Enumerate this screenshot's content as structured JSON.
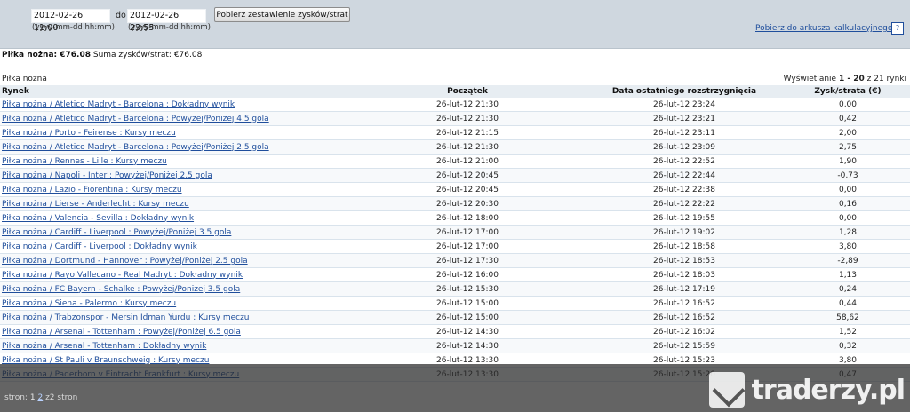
{
  "filter": {
    "from_value": "2012-02-26 11:00",
    "to_label": "do",
    "to_value": "2012-02-26 23:55",
    "from_format": "(yyyy-mm-dd hh:mm)",
    "to_format": "(yyyy-mm-dd hh:mm)",
    "button_label": "Pobierz zestawienie zysków/strat",
    "export_link": "Pobierz do arkusza kalkulacyjnego",
    "help_label": "?"
  },
  "summary": {
    "sport_label": "Piłka nożna: €76.08",
    "total_label": "Suma zysków/strat:",
    "total_value": "€76.08"
  },
  "table": {
    "section_label": "Piłka nożna",
    "paging_prefix": "Wyświetlanie",
    "paging_range": "1 - 20",
    "paging_suffix": "z 21 rynki",
    "headers": [
      "Rynek",
      "Początek",
      "Data ostatniego rozstrzygnięcia",
      "Zysk/strata (€)"
    ],
    "rows": [
      {
        "market": "Piłka nożna / Atletico Madryt - Barcelona : Dokładny wynik",
        "start": "26-lut-12 21:30",
        "settled": "26-lut-12 23:24",
        "pl": "0,00"
      },
      {
        "market": "Piłka nożna / Atletico Madryt - Barcelona : Powyżej/Poniżej 4.5 gola",
        "start": "26-lut-12 21:30",
        "settled": "26-lut-12 23:21",
        "pl": "0,42"
      },
      {
        "market": "Piłka nożna / Porto - Feirense : Kursy meczu",
        "start": "26-lut-12 21:15",
        "settled": "26-lut-12 23:11",
        "pl": "2,00"
      },
      {
        "market": "Piłka nożna / Atletico Madryt - Barcelona : Powyżej/Poniżej 2.5 gola",
        "start": "26-lut-12 21:30",
        "settled": "26-lut-12 23:09",
        "pl": "2,75"
      },
      {
        "market": "Piłka nożna / Rennes - Lille : Kursy meczu",
        "start": "26-lut-12 21:00",
        "settled": "26-lut-12 22:52",
        "pl": "1,90"
      },
      {
        "market": "Piłka nożna / Napoli - Inter : Powyżej/Poniżej 2.5 gola",
        "start": "26-lut-12 20:45",
        "settled": "26-lut-12 22:44",
        "pl": "-0,73"
      },
      {
        "market": "Piłka nożna / Lazio - Fiorentina : Kursy meczu",
        "start": "26-lut-12 20:45",
        "settled": "26-lut-12 22:38",
        "pl": "0,00"
      },
      {
        "market": "Piłka nożna / Lierse - Anderlecht : Kursy meczu",
        "start": "26-lut-12 20:30",
        "settled": "26-lut-12 22:22",
        "pl": "0,16"
      },
      {
        "market": "Piłka nożna / Valencia - Sevilla : Dokładny wynik",
        "start": "26-lut-12 18:00",
        "settled": "26-lut-12 19:55",
        "pl": "0,00"
      },
      {
        "market": "Piłka nożna / Cardiff - Liverpool : Powyżej/Poniżej 3.5 gola",
        "start": "26-lut-12 17:00",
        "settled": "26-lut-12 19:02",
        "pl": "1,28"
      },
      {
        "market": "Piłka nożna / Cardiff - Liverpool : Dokładny wynik",
        "start": "26-lut-12 17:00",
        "settled": "26-lut-12 18:58",
        "pl": "3,80"
      },
      {
        "market": "Piłka nożna / Dortmund - Hannover : Powyżej/Poniżej 2.5 gola",
        "start": "26-lut-12 17:30",
        "settled": "26-lut-12 18:53",
        "pl": "-2,89"
      },
      {
        "market": "Piłka nożna / Rayo Vallecano - Real Madryt : Dokładny wynik",
        "start": "26-lut-12 16:00",
        "settled": "26-lut-12 18:03",
        "pl": "1,13"
      },
      {
        "market": "Piłka nożna / FC Bayern - Schalke : Powyżej/Poniżej 3.5 gola",
        "start": "26-lut-12 15:30",
        "settled": "26-lut-12 17:19",
        "pl": "0,24"
      },
      {
        "market": "Piłka nożna / Siena - Palermo : Kursy meczu",
        "start": "26-lut-12 15:00",
        "settled": "26-lut-12 16:52",
        "pl": "0,44"
      },
      {
        "market": "Piłka nożna / Trabzonspor - Mersin Idman Yurdu : Kursy meczu",
        "start": "26-lut-12 15:00",
        "settled": "26-lut-12 16:52",
        "pl": "58,62"
      },
      {
        "market": "Piłka nożna / Arsenal - Tottenham : Powyżej/Poniżej 6.5 gola",
        "start": "26-lut-12 14:30",
        "settled": "26-lut-12 16:02",
        "pl": "1,52"
      },
      {
        "market": "Piłka nożna / Arsenal - Tottenham : Dokładny wynik",
        "start": "26-lut-12 14:30",
        "settled": "26-lut-12 15:59",
        "pl": "0,32"
      },
      {
        "market": "Piłka nożna / St Pauli v Braunschweig : Kursy meczu",
        "start": "26-lut-12 13:30",
        "settled": "26-lut-12 15:23",
        "pl": "3,80"
      },
      {
        "market": "Piłka nożna / Paderborn v Eintracht Frankfurt : Kursy meczu",
        "start": "26-lut-12 13:30",
        "settled": "26-lut-12 15:20",
        "pl": "0,47"
      }
    ]
  },
  "pager": {
    "label": "stron:",
    "current": "1",
    "next": "2",
    "total": "z2 stron"
  },
  "watermark": {
    "text": "traderzy.pl"
  }
}
